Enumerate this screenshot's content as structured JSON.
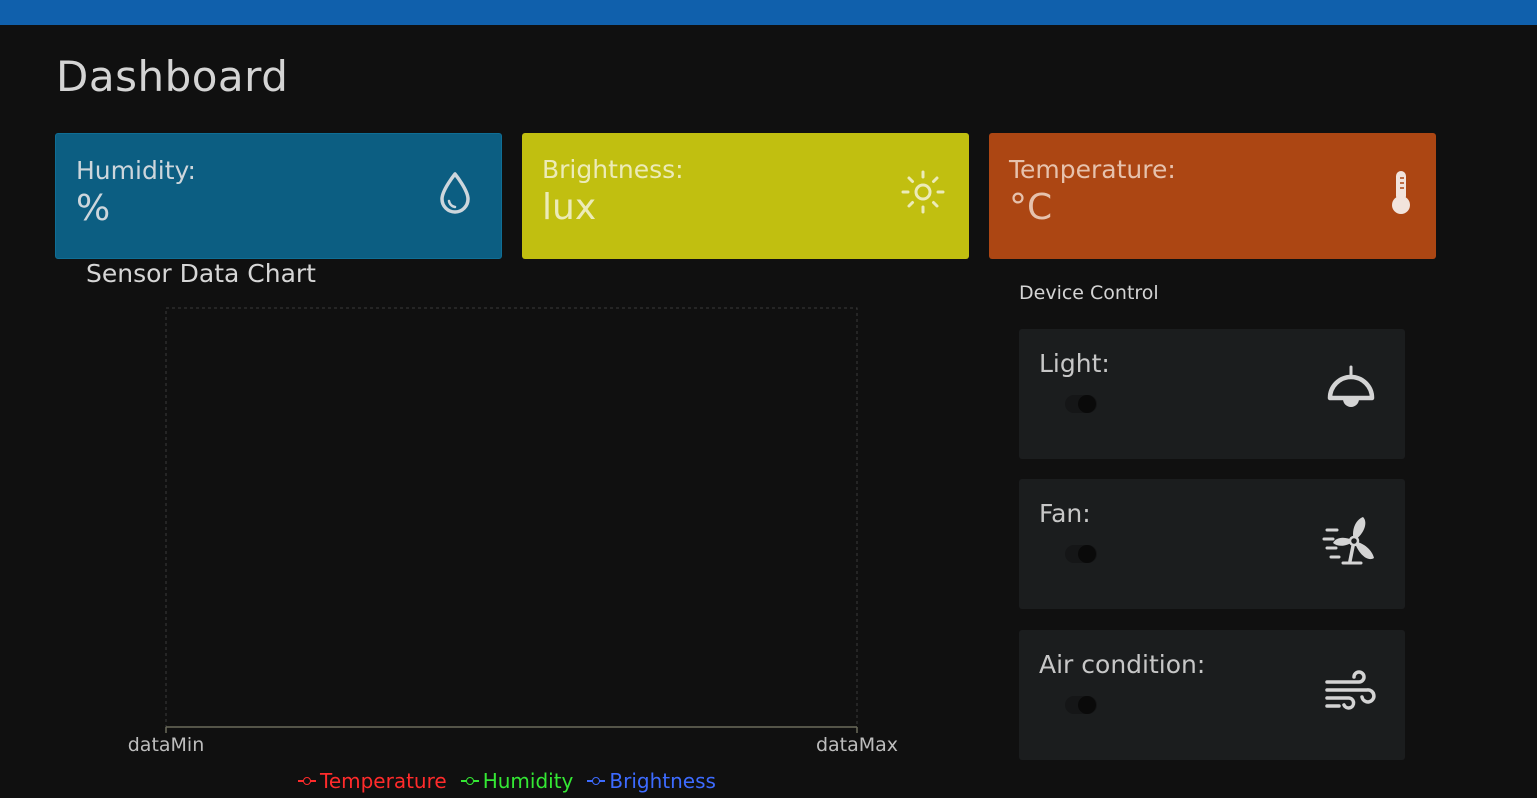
{
  "page": {
    "title": "Dashboard"
  },
  "colors": {
    "topbar": "#1060ac",
    "humidity": "#0c5e82",
    "brightness": "#c1bf10",
    "temperature": "#ac4613"
  },
  "cards": {
    "humidity": {
      "label": "Humidity:",
      "unit": "%",
      "icon": "droplet-icon"
    },
    "brightness": {
      "label": "Brightness:",
      "unit": "lux",
      "icon": "sun-icon"
    },
    "temperature": {
      "label": "Temperature:",
      "unit": "°C",
      "icon": "thermometer-icon"
    }
  },
  "chart": {
    "title": "Sensor Data Chart"
  },
  "chart_data": {
    "type": "line",
    "title": "Sensor Data Chart",
    "x_ticks": [
      "dataMin",
      "dataMax"
    ],
    "series": [
      {
        "name": "Temperature",
        "color": "#ff2b2b",
        "values": []
      },
      {
        "name": "Humidity",
        "color": "#34e834",
        "values": []
      },
      {
        "name": "Brightness",
        "color": "#3d6bff",
        "values": []
      }
    ],
    "grid": true,
    "legend": "bottom"
  },
  "devices": {
    "title": "Device Control",
    "items": [
      {
        "label": "Light:",
        "icon": "ceiling-lamp-icon",
        "state": "off"
      },
      {
        "label": "Fan:",
        "icon": "fan-icon",
        "state": "off"
      },
      {
        "label": "Air condition:",
        "icon": "wind-icon",
        "state": "off"
      }
    ]
  }
}
